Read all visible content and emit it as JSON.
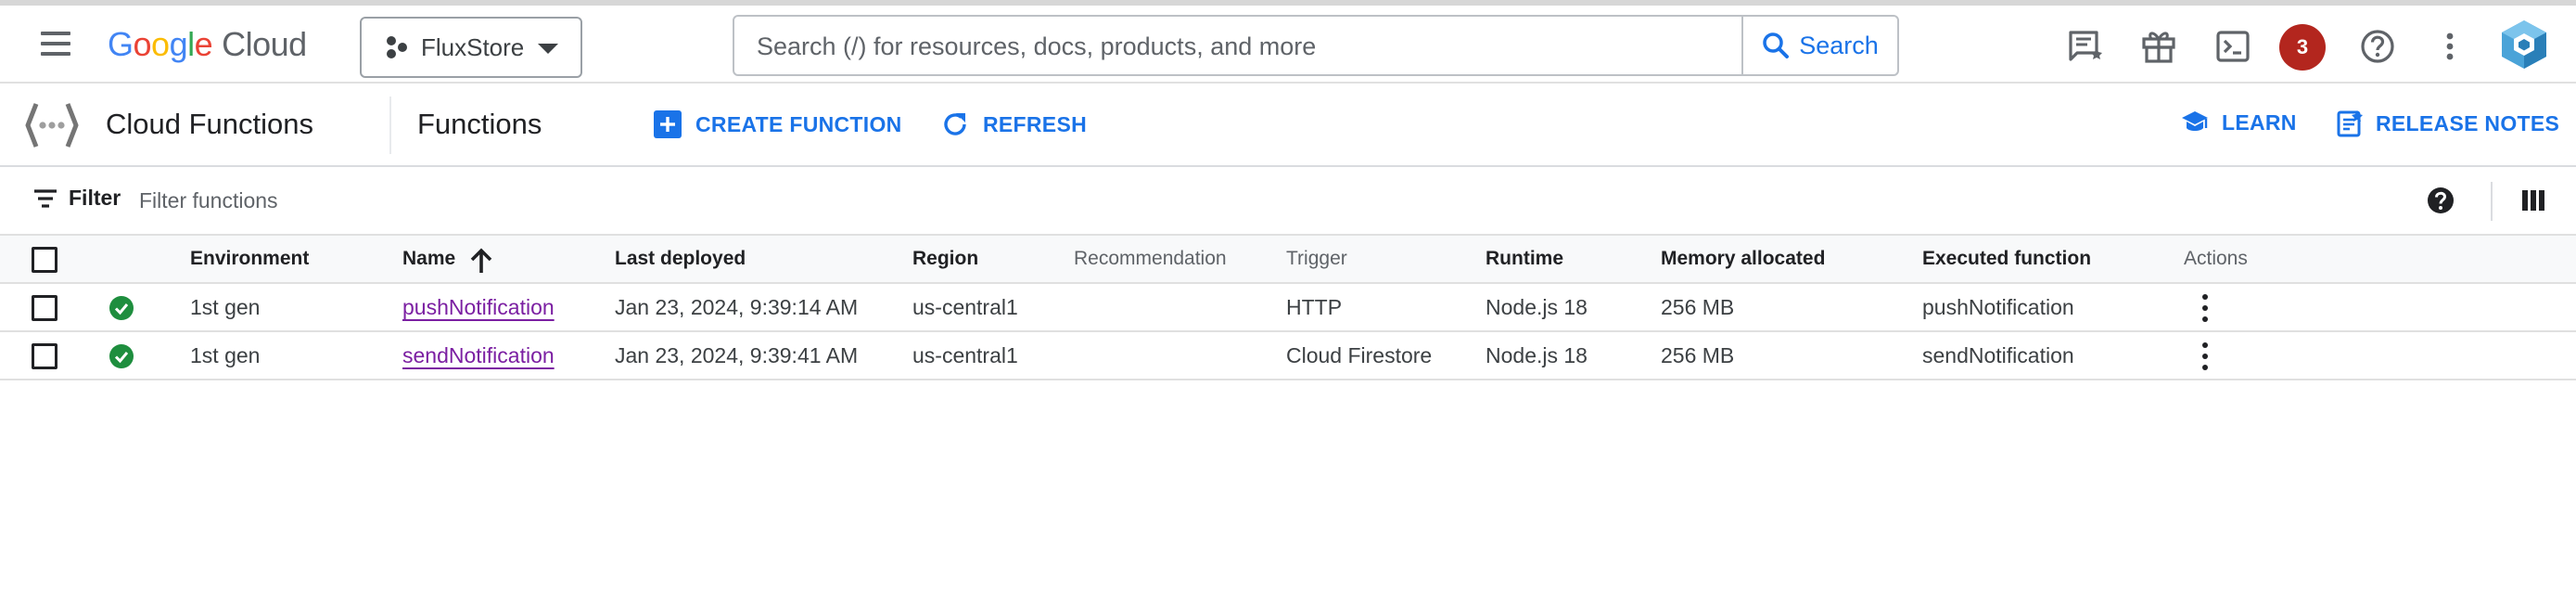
{
  "topbar": {
    "logo": {
      "letters": [
        "G",
        "o",
        "o",
        "g",
        "l",
        "e"
      ],
      "suffix": "Cloud"
    },
    "project_name": "FluxStore",
    "search": {
      "placeholder": "Search (/) for resources, docs, products, and more",
      "value": "",
      "button_label": "Search"
    },
    "notification_count": "3",
    "icons": [
      "menu-icon",
      "release-notes-icon",
      "gift-icon",
      "cloud-shell-icon",
      "help-icon",
      "more-vert-icon",
      "account-avatar-icon"
    ]
  },
  "header": {
    "product_title": "Cloud Functions",
    "page_title": "Functions",
    "create_label": "CREATE FUNCTION",
    "refresh_label": "REFRESH",
    "learn_label": "LEARN",
    "release_notes_label": "RELEASE NOTES"
  },
  "filter": {
    "label": "Filter",
    "placeholder": "Filter functions"
  },
  "table": {
    "columns": {
      "environment": "Environment",
      "name": "Name",
      "last_deployed": "Last deployed",
      "region": "Region",
      "recommendation": "Recommendation",
      "trigger": "Trigger",
      "runtime": "Runtime",
      "memory": "Memory allocated",
      "executed": "Executed function",
      "actions": "Actions"
    },
    "sort": {
      "column": "Name",
      "direction": "ascending"
    },
    "rows": [
      {
        "status": "ok",
        "environment": "1st gen",
        "name": "pushNotification",
        "last_deployed": "Jan 23, 2024, 9:39:14 AM",
        "region": "us-central1",
        "recommendation": "",
        "trigger": "HTTP",
        "runtime": "Node.js 18",
        "memory": "256 MB",
        "executed": "pushNotification"
      },
      {
        "status": "ok",
        "environment": "1st gen",
        "name": "sendNotification",
        "last_deployed": "Jan 23, 2024, 9:39:41 AM",
        "region": "us-central1",
        "recommendation": "",
        "trigger": "Cloud Firestore",
        "runtime": "Node.js 18",
        "memory": "256 MB",
        "executed": "sendNotification"
      }
    ]
  },
  "colors": {
    "accent": "#1a73e8",
    "link_visited": "#7b1fa2",
    "status_ok": "#1e8e3e",
    "notification_badge": "#b3261e"
  }
}
